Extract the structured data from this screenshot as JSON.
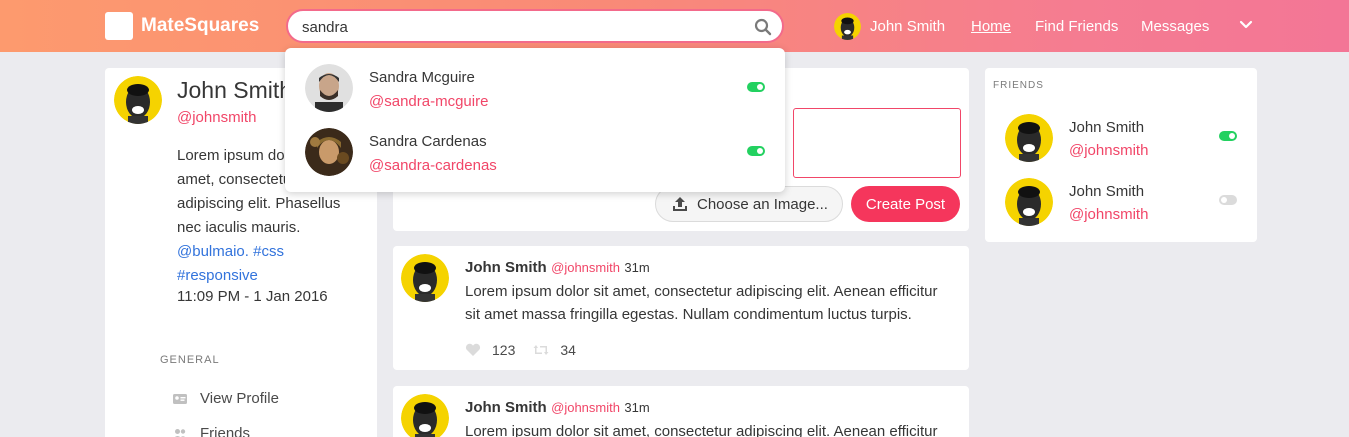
{
  "navbar": {
    "brand": "MateSquares",
    "search_value": "sandra",
    "user_name": "John Smith",
    "links": {
      "home": "Home",
      "find_friends": "Find Friends",
      "messages": "Messages"
    }
  },
  "search_results": [
    {
      "name": "Sandra Mcguire",
      "handle": "@sandra-mcguire",
      "online": true
    },
    {
      "name": "Sandra Cardenas",
      "handle": "@sandra-cardenas",
      "online": true
    }
  ],
  "profile": {
    "name": "John Smith",
    "handle": "@johnsmith",
    "bio_text": "Lorem ipsum dolor sit amet, consectetur adipiscing elit. Phasellus nec iaculis mauris.",
    "bio_lines": [
      "Lorem ipsum do",
      "amet, consectetu",
      "adipiscing elit. Phasellus",
      "nec iaculis mauris."
    ],
    "tags": [
      "@bulmaio.",
      "#css",
      "#responsive"
    ],
    "time": "11:09 PM - 1 Jan 2016"
  },
  "menu": {
    "label": "GENERAL",
    "items": [
      "View Profile",
      "Friends"
    ]
  },
  "composer": {
    "choose_label": "Choose an Image...",
    "create_label": "Create Post"
  },
  "posts": [
    {
      "author": "John Smith",
      "handle": "@johnsmith",
      "time": "31m",
      "body": "Lorem ipsum dolor sit amet, consectetur adipiscing elit. Aenean efficitur sit amet massa fringilla egestas. Nullam condimentum luctus turpis.",
      "likes": "123",
      "retweets": "34"
    },
    {
      "author": "John Smith",
      "handle": "@johnsmith",
      "time": "31m",
      "body": "Lorem ipsum dolor sit amet, consectetur adipiscing elit. Aenean efficitur"
    }
  ],
  "friends": {
    "title": "FRIENDS",
    "items": [
      {
        "name": "John Smith",
        "handle": "@johnsmith",
        "online": true
      },
      {
        "name": "John Smith",
        "handle": "@johnsmith",
        "online": false
      }
    ]
  },
  "colors": {
    "accent": "#f14668",
    "online": "#23d160",
    "link": "#3273dc"
  }
}
